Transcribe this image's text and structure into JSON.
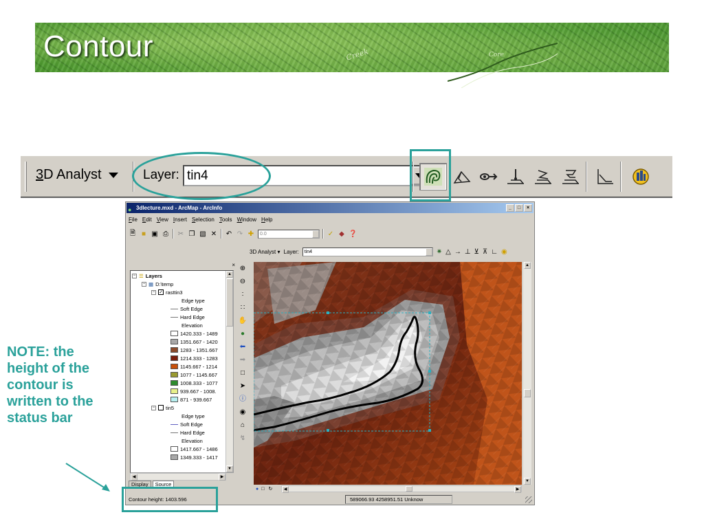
{
  "slide": {
    "title": "Contour",
    "map_labels": {
      "creek": "Creek",
      "core": "Core"
    },
    "note": "NOTE: the height of the contour is written to the status bar",
    "accent_color": "#2aa19a"
  },
  "big_toolbar": {
    "analyst_prefix": "3",
    "analyst_label": "D Analyst",
    "layer_label": "Layer:",
    "layer_value": "tin4",
    "tools": [
      "contour-icon",
      "steepest-path-icon",
      "line-of-sight-icon",
      "profile-point-icon",
      "interpolate-line-icon",
      "interpolate-polygon-icon",
      "profile-graph-icon",
      "arcscene-icon"
    ]
  },
  "arcmap": {
    "title": "3dlecture.mxd - ArcMap - ArcInfo",
    "menu": [
      "File",
      "Edit",
      "View",
      "Insert",
      "Selection",
      "Tools",
      "Window",
      "Help"
    ],
    "scale_value": "0.0",
    "analyst_label": "3D Analyst",
    "layer_label": "Layer:",
    "layer_value": "tin4",
    "toc": {
      "root": "Layers",
      "folder": "D:\\temp",
      "layer1": {
        "name": "rasttin3",
        "edge_type": "Edge type",
        "soft_edge": "Soft Edge",
        "hard_edge": "Hard Edge",
        "elevation": "Elevation",
        "classes": [
          {
            "label": "1420.333 - 1489",
            "color": "#ffffff"
          },
          {
            "label": "1351.667 - 1420",
            "color": "#a8a8a8"
          },
          {
            "label": "1283 - 1351.667",
            "color": "#8b4a2a"
          },
          {
            "label": "1214.333 - 1283",
            "color": "#7a1e0c"
          },
          {
            "label": "1145.667 - 1214",
            "color": "#c8500a"
          },
          {
            "label": "1077 - 1145.667",
            "color": "#9a9a30"
          },
          {
            "label": "1008.333 - 1077",
            "color": "#2e8b2e"
          },
          {
            "label": "939.667 - 1008.",
            "color": "#e8f08a"
          },
          {
            "label": "871 - 939.667",
            "color": "#b8f0f0"
          }
        ]
      },
      "layer2": {
        "name": "tin5",
        "edge_type": "Edge type",
        "soft_edge": "Soft Edge",
        "hard_edge": "Hard Edge",
        "elevation": "Elevation",
        "classes": [
          {
            "label": "1417.667 - 1486",
            "color": "#ffffff"
          },
          {
            "label": "1349.333 - 1417",
            "color": "#a8a8a8"
          }
        ]
      },
      "tabs": [
        "Display",
        "Source"
      ]
    },
    "status": {
      "contour_height": "Contour height:  1403.596",
      "coords": "589066.93  4258951.51 Unknow"
    }
  }
}
